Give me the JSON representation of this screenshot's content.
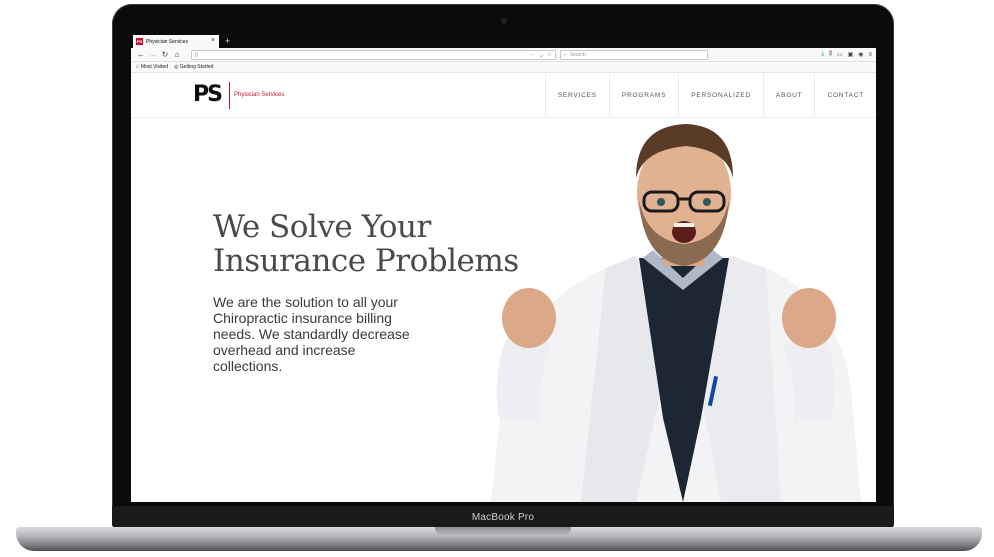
{
  "device": {
    "model_label": "MacBook Pro"
  },
  "browser": {
    "tab": {
      "title": "Physician Services",
      "favicon_text": "PS"
    },
    "new_tab_symbol": "+",
    "search_placeholder": "Search",
    "bookmarks": [
      "Most Visited",
      "Getting Started"
    ]
  },
  "site": {
    "logo": {
      "mark": "PS",
      "text": "Physician Services",
      "accent": "#c8102e"
    },
    "nav": [
      "SERVICES",
      "PROGRAMS",
      "PERSONALIZED",
      "ABOUT",
      "CONTACT"
    ],
    "hero": {
      "title_line1": "We Solve Your",
      "title_line2": "Insurance Problems",
      "text": "We are the solution to all your Chiropractic insurance billing needs. We standardly decrease overhead and increase collections."
    }
  },
  "icons": [
    "back-icon",
    "forward-icon",
    "reload-icon",
    "home-icon",
    "page-icon",
    "more-icon",
    "pocket-icon",
    "bookmark-star-icon",
    "search-icon",
    "download-icon",
    "library-icon",
    "sidebar-icon",
    "screenshot-icon",
    "account-icon",
    "menu-icon"
  ]
}
